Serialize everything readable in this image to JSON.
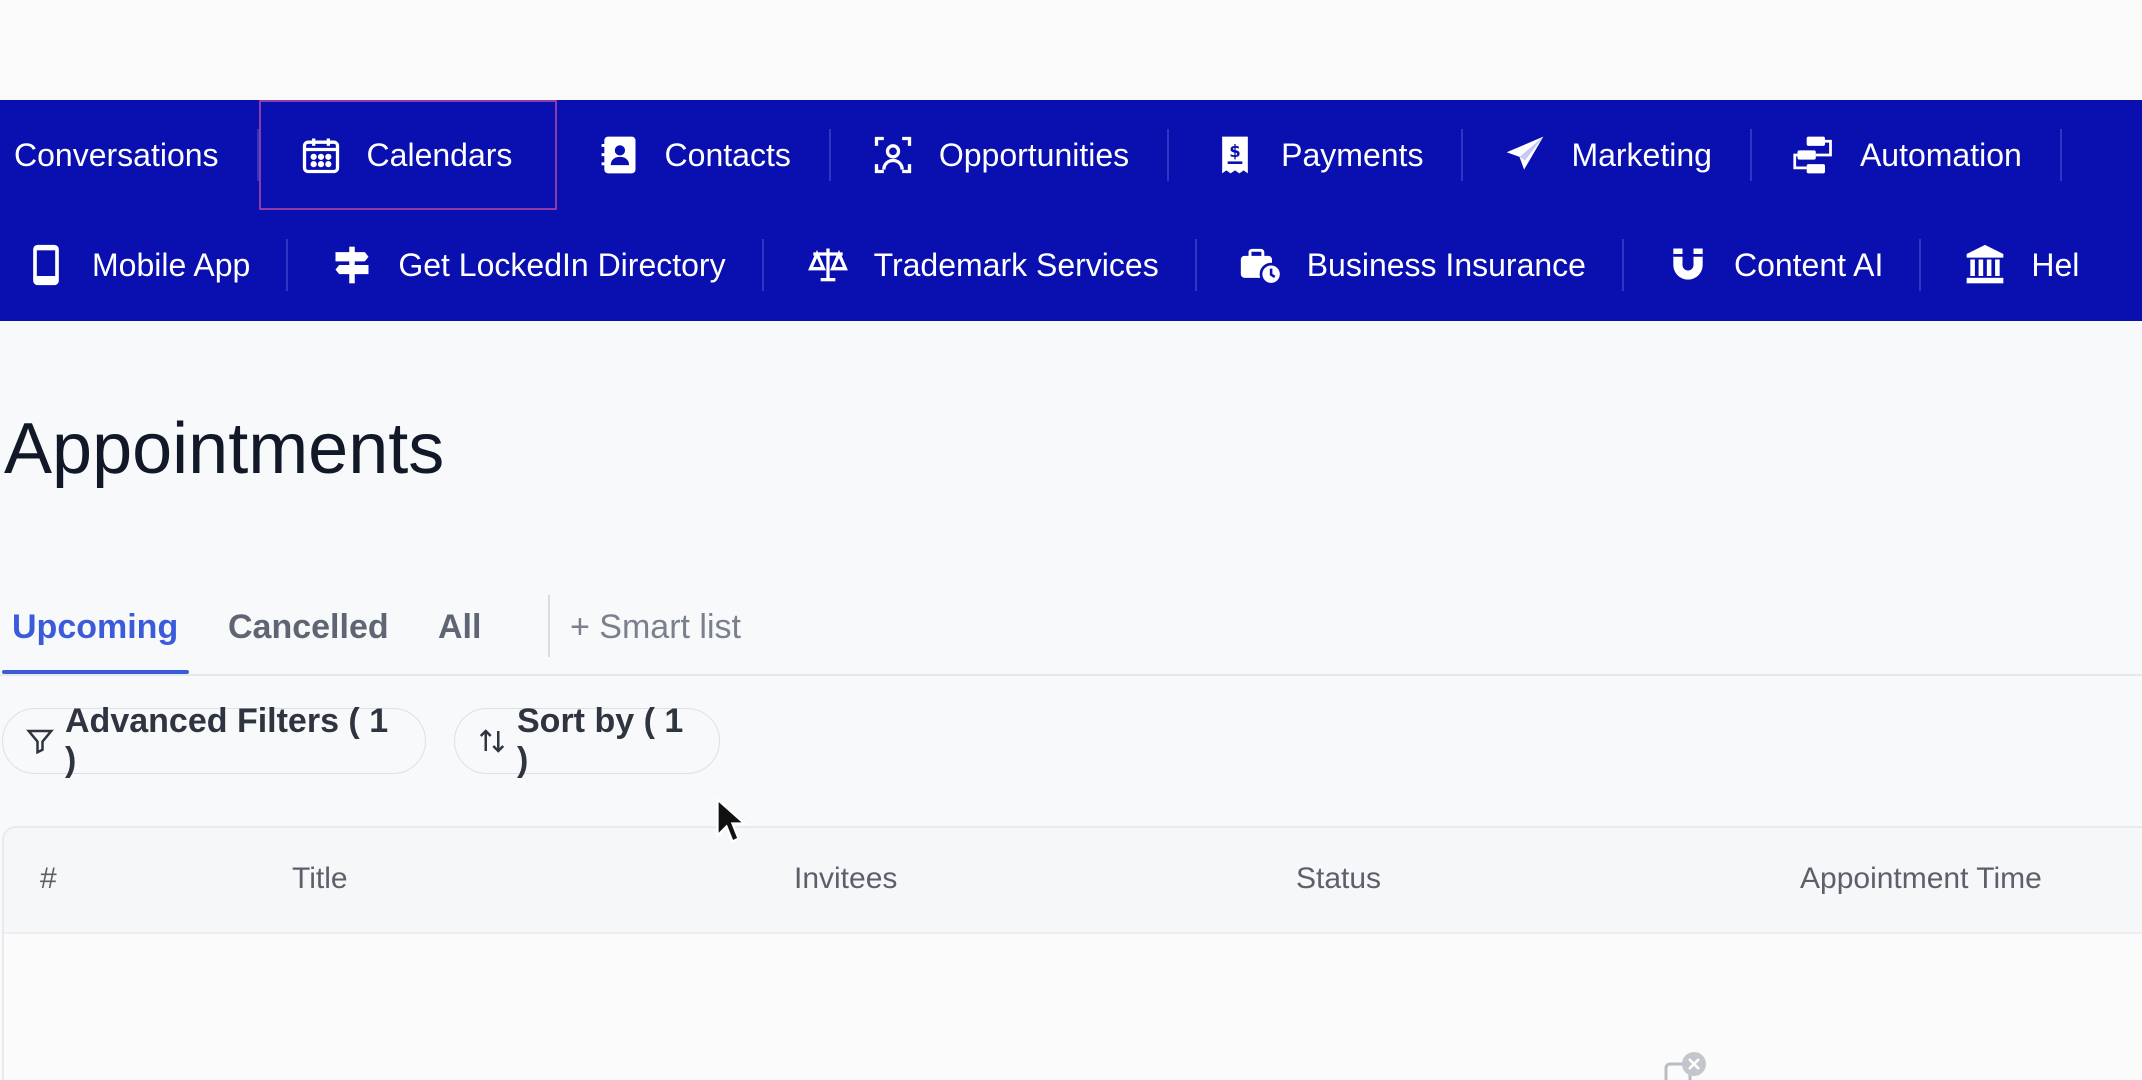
{
  "nav": {
    "row1": [
      {
        "label": "Conversations",
        "icon": "none"
      },
      {
        "label": "Calendars",
        "icon": "calendar-icon"
      },
      {
        "label": "Contacts",
        "icon": "contact-book-icon"
      },
      {
        "label": "Opportunities",
        "icon": "target-icon"
      },
      {
        "label": "Payments",
        "icon": "receipt-dollar-icon"
      },
      {
        "label": "Marketing",
        "icon": "paper-plane-icon"
      },
      {
        "label": "Automation",
        "icon": "workflow-icon"
      }
    ],
    "row2": [
      {
        "label": "Mobile App",
        "icon": "mobile-icon"
      },
      {
        "label": "Get LockedIn Directory",
        "icon": "signpost-icon"
      },
      {
        "label": "Trademark Services",
        "icon": "scales-icon"
      },
      {
        "label": "Business Insurance",
        "icon": "briefcase-clock-icon"
      },
      {
        "label": "Content AI",
        "icon": "magnet-icon"
      },
      {
        "label": "Hel",
        "icon": "bank-icon"
      }
    ],
    "active": "Calendars",
    "bg_color": "#0a0fb0"
  },
  "page": {
    "title": "Appointments"
  },
  "tabs": {
    "items": [
      "Upcoming",
      "Cancelled",
      "All"
    ],
    "active": "Upcoming",
    "smart_list": "+ Smart list",
    "accent": "#3b5bdb"
  },
  "toolbar": {
    "filters_label": "Advanced Filters ( 1 )",
    "sort_label": "Sort by ( 1 )"
  },
  "table": {
    "columns": [
      "#",
      "Title",
      "Invitees",
      "Status",
      "Appointment Time"
    ]
  }
}
